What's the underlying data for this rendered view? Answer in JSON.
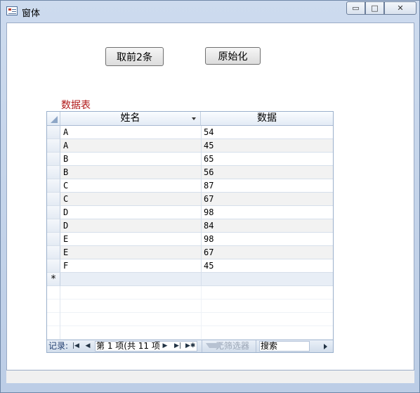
{
  "window": {
    "title": "窗体",
    "controls": {
      "minimize": "▭",
      "maximize": "□",
      "close": "✕"
    }
  },
  "buttons": {
    "take_first": "取前2条",
    "reset": "原始化"
  },
  "table_label": "数据表",
  "grid": {
    "columns": [
      "姓名",
      "数据"
    ],
    "rows": [
      {
        "name": "A",
        "value": "54"
      },
      {
        "name": "A",
        "value": "45"
      },
      {
        "name": "B",
        "value": "65"
      },
      {
        "name": "B",
        "value": "56"
      },
      {
        "name": "C",
        "value": "87"
      },
      {
        "name": "C",
        "value": "67"
      },
      {
        "name": "D",
        "value": "98"
      },
      {
        "name": "D",
        "value": "84"
      },
      {
        "name": "E",
        "value": "98"
      },
      {
        "name": "E",
        "value": "67"
      },
      {
        "name": "F",
        "value": "45"
      }
    ],
    "new_row_marker": "*"
  },
  "navigator": {
    "record_label": "记录:",
    "first": "|◀",
    "prev": "◀",
    "count_text": "第 1 项(共 11 项",
    "next": "▶",
    "last": "▶|",
    "new": "▶✱",
    "filter_text": "无筛选器",
    "search_text": "搜索"
  },
  "icons": [
    "form-icon",
    "minimize-icon",
    "maximize-icon",
    "close-icon",
    "dropdown-arrow-icon",
    "row-selector-corner-icon",
    "filter-icon"
  ]
}
